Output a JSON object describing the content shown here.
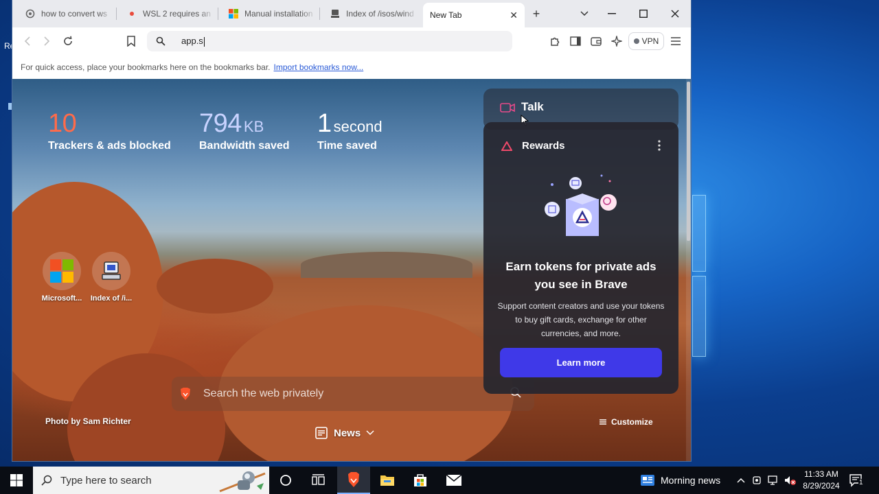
{
  "browser": {
    "tabs": [
      {
        "label": "how to convert ws",
        "icon": "brave-search-icon"
      },
      {
        "label": "WSL 2 requires an",
        "icon": "red-dot-icon"
      },
      {
        "label": "Manual installation",
        "icon": "microsoft-icon"
      },
      {
        "label": "Index of /isos/wind",
        "icon": "server-icon"
      },
      {
        "label": "New Tab",
        "icon": "none",
        "active": true
      }
    ],
    "address_value": "app.s",
    "vpn_label": "VPN",
    "bookmarks_hint": "For quick access, place your bookmarks here on the bookmarks bar.",
    "import_link": "Import bookmarks now..."
  },
  "ntp": {
    "stats": [
      {
        "value": "10",
        "unit": "",
        "label": "Trackers & ads blocked",
        "color": "#ff6b4a"
      },
      {
        "value": "794",
        "unit": "KB",
        "label": "Bandwidth saved",
        "color": "#c9d3ff"
      },
      {
        "value": "1",
        "unit": "second",
        "label": "Time saved",
        "color": "#ffffff"
      }
    ],
    "tiles": [
      {
        "label": "Microsoft...",
        "icon": "microsoft-icon"
      },
      {
        "label": "Index of /i...",
        "icon": "server-icon"
      }
    ],
    "search_placeholder": "Search the web privately",
    "photo_credit": "Photo by Sam Richter",
    "news_label": "News",
    "customize_label": "Customize",
    "talk_label": "Talk",
    "rewards": {
      "title": "Rewards",
      "heading": "Earn tokens for private ads you see in Brave",
      "body": "Support content creators and use your tokens to buy gift cards, exchange for other currencies, and more.",
      "button": "Learn more",
      "accent": "#3f39e8"
    }
  },
  "taskbar": {
    "search_placeholder": "Type here to search",
    "news_label": "Morning news",
    "time": "11:33 AM",
    "date": "8/29/2024",
    "notification_count": "1"
  }
}
